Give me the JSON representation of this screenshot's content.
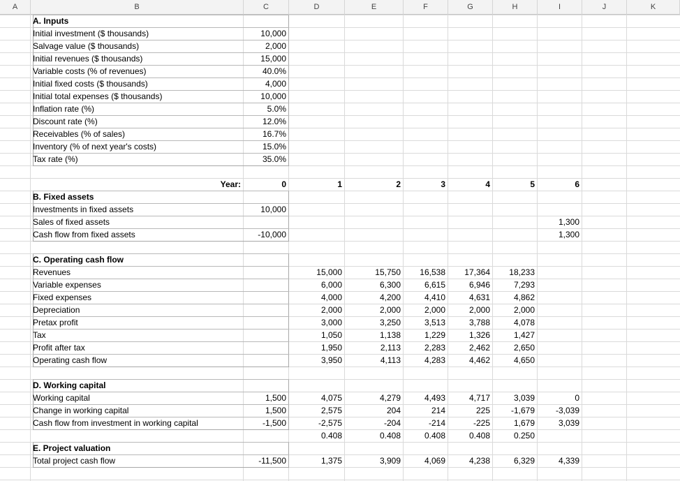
{
  "columns": [
    "A",
    "B",
    "C",
    "D",
    "E",
    "F",
    "G",
    "H",
    "I",
    "J",
    "K"
  ],
  "sections": {
    "inputs": {
      "title": "A. Inputs",
      "rows": [
        {
          "label": "Initial investment ($ thousands)",
          "value": "10,000"
        },
        {
          "label": "Salvage value ($ thousands)",
          "value": "2,000"
        },
        {
          "label": "Initial revenues ($ thousands)",
          "value": "15,000"
        },
        {
          "label": "Variable costs (% of revenues)",
          "value": "40.0%"
        },
        {
          "label": "Initial fixed costs ($ thousands)",
          "value": "4,000"
        },
        {
          "label": "Initial total expenses ($ thousands)",
          "value": "10,000"
        },
        {
          "label": "Inflation rate (%)",
          "value": "5.0%"
        },
        {
          "label": "Discount rate (%)",
          "value": "12.0%"
        },
        {
          "label": "Receivables (% of sales)",
          "value": "16.7%"
        },
        {
          "label": "Inventory (% of next year's costs)",
          "value": "15.0%"
        },
        {
          "label": "Tax rate (%)",
          "value": "35.0%"
        }
      ]
    },
    "year_row": {
      "label": "Year:",
      "values": [
        "0",
        "1",
        "2",
        "3",
        "4",
        "5",
        "6"
      ]
    },
    "fixed_assets": {
      "title": "B. Fixed assets",
      "rows": [
        {
          "label": "Investments in fixed assets",
          "values": [
            "10,000",
            "",
            "",
            "",
            "",
            "",
            ""
          ]
        },
        {
          "label": "Sales of fixed assets",
          "values": [
            "",
            "",
            "",
            "",
            "",
            "",
            "1,300"
          ]
        },
        {
          "label": "Cash flow from fixed assets",
          "values": [
            "-10,000",
            "",
            "",
            "",
            "",
            "",
            "1,300"
          ]
        }
      ]
    },
    "operating": {
      "title": "C. Operating cash flow",
      "rows": [
        {
          "label": "Revenues",
          "values": [
            "",
            "15,000",
            "15,750",
            "16,538",
            "17,364",
            "18,233",
            ""
          ]
        },
        {
          "label": "Variable expenses",
          "values": [
            "",
            "6,000",
            "6,300",
            "6,615",
            "6,946",
            "7,293",
            ""
          ]
        },
        {
          "label": "Fixed expenses",
          "values": [
            "",
            "4,000",
            "4,200",
            "4,410",
            "4,631",
            "4,862",
            ""
          ]
        },
        {
          "label": "Depreciation",
          "values": [
            "",
            "2,000",
            "2,000",
            "2,000",
            "2,000",
            "2,000",
            ""
          ]
        },
        {
          "label": "Pretax profit",
          "values": [
            "",
            "3,000",
            "3,250",
            "3,513",
            "3,788",
            "4,078",
            ""
          ]
        },
        {
          "label": "Tax",
          "values": [
            "",
            "1,050",
            "1,138",
            "1,229",
            "1,326",
            "1,427",
            ""
          ]
        },
        {
          "label": "Profit after tax",
          "values": [
            "",
            "1,950",
            "2,113",
            "2,283",
            "2,462",
            "2,650",
            ""
          ]
        },
        {
          "label": "Operating cash flow",
          "values": [
            "",
            "3,950",
            "4,113",
            "4,283",
            "4,462",
            "4,650",
            ""
          ]
        }
      ]
    },
    "working_capital": {
      "title": "D. Working capital",
      "rows": [
        {
          "label": "Working capital",
          "values": [
            "1,500",
            "4,075",
            "4,279",
            "4,493",
            "4,717",
            "3,039",
            "0"
          ]
        },
        {
          "label": "Change in working capital",
          "values": [
            "1,500",
            "2,575",
            "204",
            "214",
            "225",
            "-1,679",
            "-3,039"
          ]
        },
        {
          "label": "Cash flow from investment in working capital",
          "values": [
            "-1,500",
            "-2,575",
            "-204",
            "-214",
            "-225",
            "1,679",
            "3,039"
          ]
        },
        {
          "label": "",
          "values": [
            "",
            "0.408",
            "0.408",
            "0.408",
            "0.408",
            "0.250",
            ""
          ]
        }
      ]
    },
    "valuation": {
      "title": "E. Project valuation",
      "rows": [
        {
          "label": "Total project cash flow",
          "values": [
            "-11,500",
            "1,375",
            "3,909",
            "4,069",
            "4,238",
            "6,329",
            "4,339"
          ]
        }
      ]
    }
  }
}
